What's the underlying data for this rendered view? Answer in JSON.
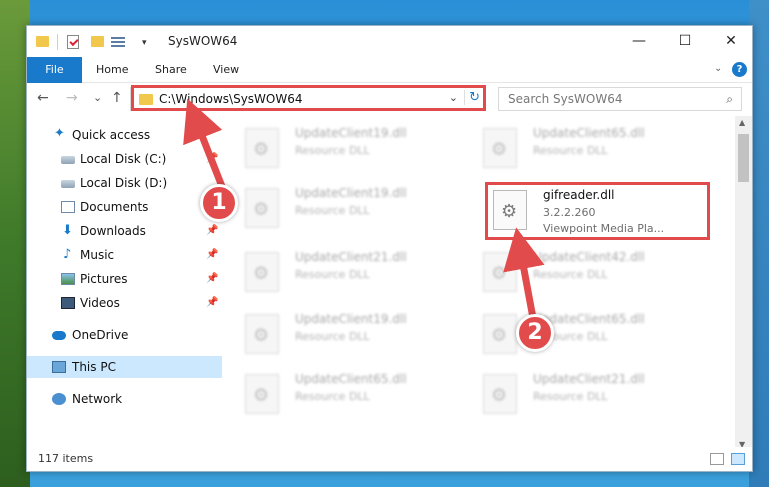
{
  "window": {
    "title": "SysWOW64",
    "controls": {
      "minimize": "—",
      "maximize": "☐",
      "close": "✕"
    }
  },
  "ribbon": {
    "file_tab": "File",
    "tabs": [
      "Home",
      "Share",
      "View"
    ],
    "help": "?"
  },
  "navigation": {
    "back": "←",
    "forward": "→",
    "recent": "⌄",
    "up": "↑",
    "address": "C:\\Windows\\SysWOW64",
    "search_placeholder": "Search SysWOW64"
  },
  "sidebar": {
    "items": [
      {
        "label": "Quick access",
        "icon": "star-icon"
      },
      {
        "label": "Local Disk (C:)",
        "icon": "disk-icon",
        "pinned": true
      },
      {
        "label": "Local Disk (D:)",
        "icon": "disk-icon",
        "pinned": false
      },
      {
        "label": "Documents",
        "icon": "documents-icon",
        "pinned": true
      },
      {
        "label": "Downloads",
        "icon": "download-icon",
        "pinned": true
      },
      {
        "label": "Music",
        "icon": "music-icon",
        "pinned": true
      },
      {
        "label": "Pictures",
        "icon": "pictures-icon",
        "pinned": true
      },
      {
        "label": "Videos",
        "icon": "videos-icon",
        "pinned": true
      },
      {
        "label": "OneDrive",
        "icon": "onedrive-icon"
      },
      {
        "label": "This PC",
        "icon": "this-pc-icon",
        "selected": true
      },
      {
        "label": "Network",
        "icon": "network-icon"
      }
    ]
  },
  "files": [
    {
      "name": "UpdateClient19.dll",
      "desc": "Resource DLL"
    },
    {
      "name": "UpdateClient65.dll",
      "desc": "Resource DLL"
    },
    {
      "name": "UpdateClient19.dll",
      "desc": "Resource DLL"
    },
    {
      "name": "gifreader.dll",
      "desc": "3.2.2.260",
      "desc2": "Viewpoint Media Pla...",
      "highlighted": true
    },
    {
      "name": "UpdateClient21.dll",
      "desc": "Resource DLL"
    },
    {
      "name": "UpdateClient42.dll",
      "desc": "Resource DLL"
    },
    {
      "name": "UpdateClient19.dll",
      "desc": "Resource DLL"
    },
    {
      "name": "UpdateClient65.dll",
      "desc": "Resource DLL"
    },
    {
      "name": "UpdateClient65.dll",
      "desc": "Resource DLL"
    },
    {
      "name": "UpdateClient21.dll",
      "desc": "Resource DLL"
    }
  ],
  "status": {
    "item_count": "117 items"
  },
  "annotations": {
    "step1": "1",
    "step2": "2",
    "highlight_color": "#e24b4b"
  },
  "colors": {
    "accent": "#1979ca",
    "selection": "#cce8ff"
  }
}
